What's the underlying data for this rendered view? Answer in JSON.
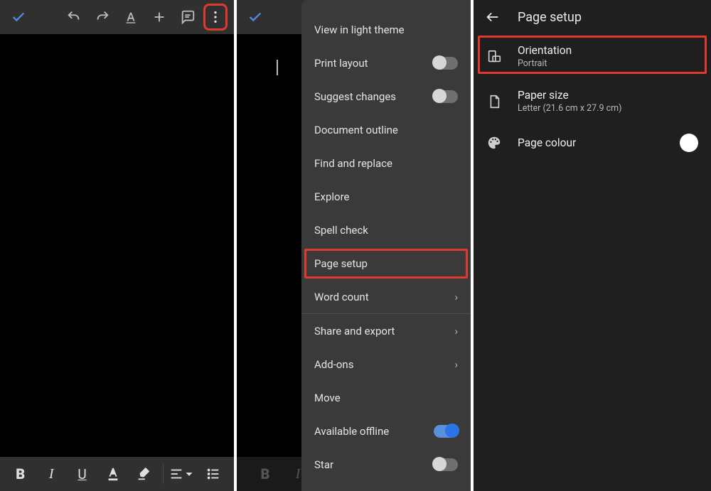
{
  "panel3": {
    "header": "Page setup",
    "orientation": {
      "title": "Orientation",
      "value": "Portrait"
    },
    "paper_size": {
      "title": "Paper size",
      "value": "Letter (21.6 cm x 27.9 cm)"
    },
    "page_colour": {
      "title": "Page colour",
      "color": "#ffffff"
    }
  },
  "menu": {
    "view_theme": "View in light theme",
    "print_layout": "Print layout",
    "suggest_changes": "Suggest changes",
    "document_outline": "Document outline",
    "find_replace": "Find and replace",
    "explore": "Explore",
    "spell_check": "Spell check",
    "page_setup": "Page setup",
    "word_count": "Word count",
    "share_export": "Share and export",
    "add_ons": "Add-ons",
    "move": "Move",
    "available_offline": "Available offline",
    "star": "Star"
  }
}
